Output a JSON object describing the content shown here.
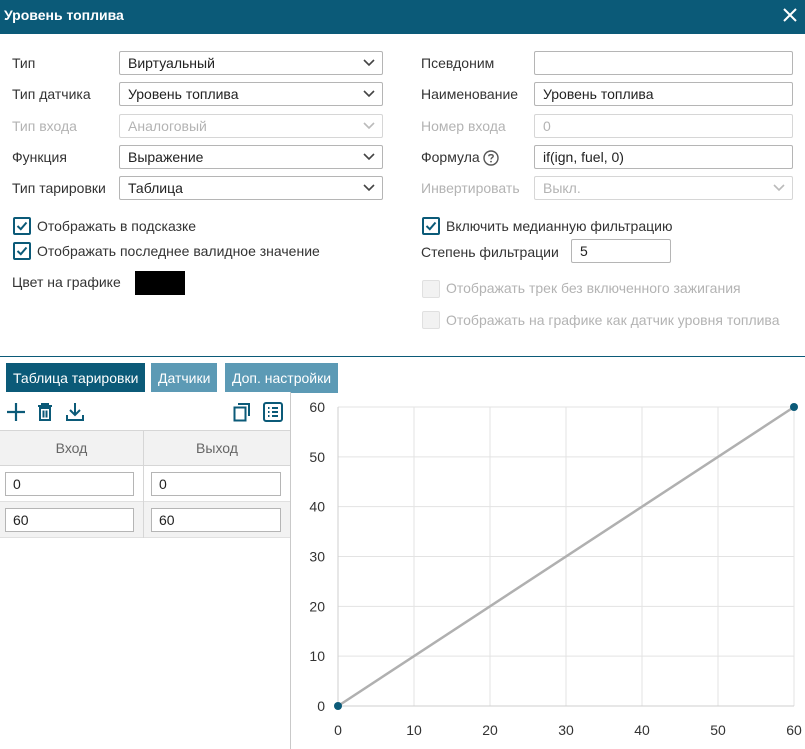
{
  "window": {
    "title": "Уровень топлива"
  },
  "form": {
    "type_label": "Тип",
    "type_value": "Виртуальный",
    "sensor_type_label": "Тип датчика",
    "sensor_type_value": "Уровень топлива",
    "input_type_label": "Тип входа",
    "input_type_value": "Аналоговый",
    "function_label": "Функция",
    "function_value": "Выражение",
    "calibration_type_label": "Тип тарировки",
    "calibration_type_value": "Таблица",
    "alias_label": "Псевдоним",
    "alias_value": "",
    "name_label": "Наименование",
    "name_value": "Уровень топлива",
    "input_number_label": "Номер входа",
    "input_number_value": "0",
    "formula_label": "Формула",
    "formula_value": "if(ign, fuel, 0)",
    "invert_label": "Инвертировать",
    "invert_value": "Выкл.",
    "show_in_tooltip_label": "Отображать в подсказке",
    "show_in_tooltip_checked": true,
    "show_last_valid_label": "Отображать последнее валидное значение",
    "show_last_valid_checked": true,
    "graph_color_label": "Цвет на графике",
    "graph_color": "#000000",
    "median_filter_label": "Включить медианную фильтрацию",
    "median_filter_checked": true,
    "filter_degree_label": "Степень фильтрации",
    "filter_degree_value": "5",
    "track_without_ignition_label": "Отображать трек без включенного зажигания",
    "track_without_ignition_checked": false,
    "show_as_fuel_sensor_label": "Отображать на графике как датчик уровня топлива",
    "show_as_fuel_sensor_checked": false
  },
  "tabs": [
    {
      "label": "Таблица тарировки",
      "active": true
    },
    {
      "label": "Датчики",
      "active": false
    },
    {
      "label": "Доп. настройки",
      "active": false
    }
  ],
  "toolbar": {
    "icons": [
      "plus-icon",
      "trash-icon",
      "download-icon",
      "copy-icon",
      "list-icon"
    ]
  },
  "table": {
    "headers": [
      "Вход",
      "Выход"
    ],
    "rows": [
      [
        "0",
        "0"
      ],
      [
        "60",
        "60"
      ]
    ]
  },
  "colors": {
    "accent": "#0b5a78",
    "tab_inactive": "#5c9ab5",
    "line": "#b0b0b0",
    "point": "#0b5a78"
  },
  "chart_data": {
    "type": "line",
    "x": [
      0,
      60
    ],
    "y": [
      0,
      60
    ],
    "xlim": [
      0,
      60
    ],
    "ylim": [
      0,
      60
    ],
    "xticks": [
      0,
      10,
      20,
      30,
      40,
      50,
      60
    ],
    "yticks": [
      0,
      10,
      20,
      30,
      40,
      50,
      60
    ],
    "grid": true
  }
}
